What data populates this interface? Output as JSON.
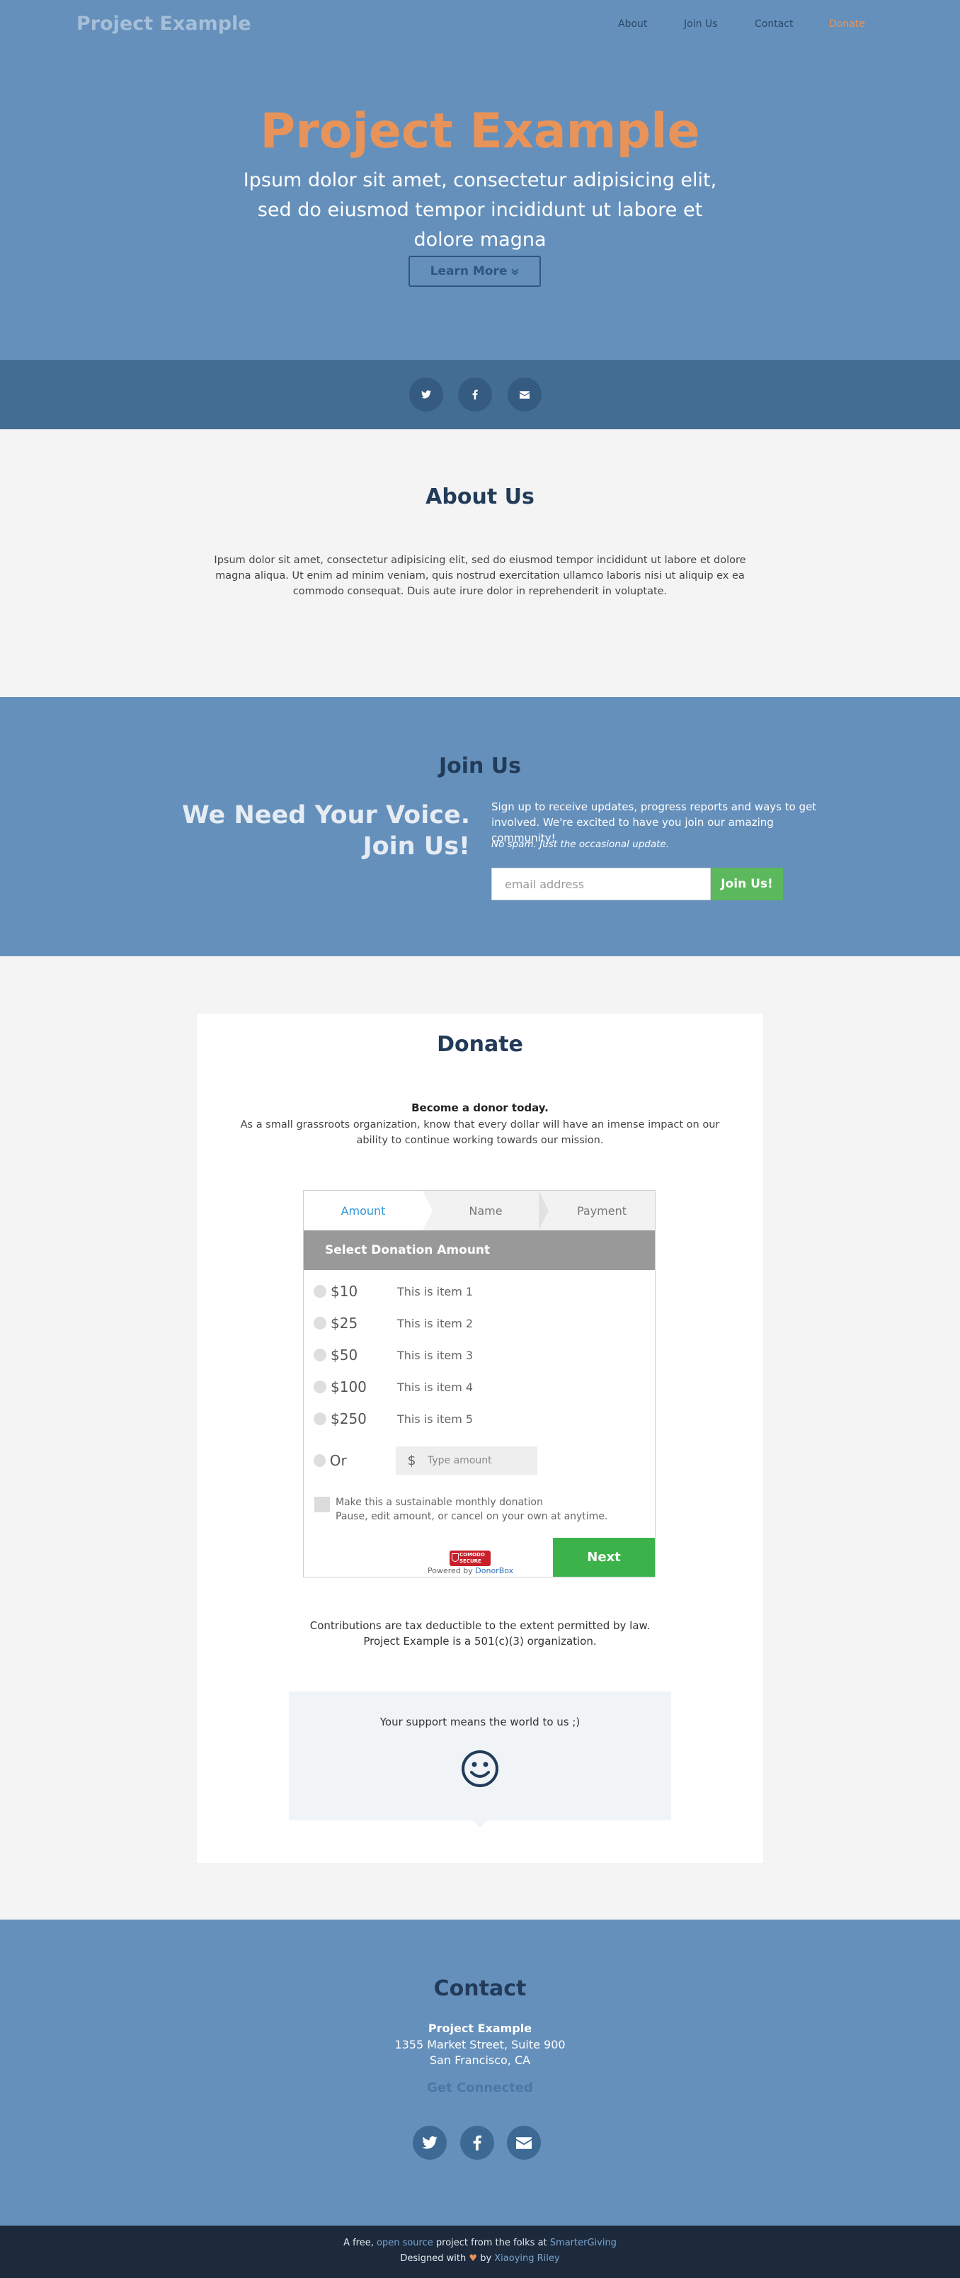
{
  "nav": {
    "brand": "Project Example",
    "links": [
      "About",
      "Join Us",
      "Contact",
      "Donate"
    ]
  },
  "hero": {
    "title": "Project Example",
    "subtitle": "Ipsum dolor sit amet, consectetur adipisicing elit, sed do eiusmod tempor incididunt ut labore et dolore magna",
    "button_label": "Learn More",
    "button_icon": "chevron-down-icon"
  },
  "social_icons": [
    "twitter-icon",
    "facebook-icon",
    "envelope-icon"
  ],
  "about": {
    "title": "About Us",
    "text": "Ipsum dolor sit amet, consectetur adipisicing elit, sed do eiusmod tempor incididunt ut labore et dolore magna aliqua. Ut enim ad minim veniam, quis nostrud exercitation ullamco laboris nisi ut aliquip ex ea commodo consequat. Duis aute irure dolor in reprehenderit in voluptate."
  },
  "join": {
    "title": "Join Us",
    "headline_1": "We Need Your Voice.",
    "headline_2": "Join Us!",
    "description": "Sign up to receive updates, progress reports and ways to get involved. We're excited to have you join our amazing community!",
    "note": "No spam. Just the occasional update.",
    "email_placeholder": "email address",
    "button_label": "Join Us!"
  },
  "donate": {
    "title": "Donate",
    "lead": "Become a donor today.",
    "text": "As a small grassroots organization, know that every dollar will have an imense impact on our ability to continue working towards our mission.",
    "widget": {
      "steps": [
        "Amount",
        "Name",
        "Payment"
      ],
      "active_step": "Amount",
      "header": "Select Donation Amount",
      "amounts": [
        {
          "value": "$10",
          "label": "This is item 1"
        },
        {
          "value": "$25",
          "label": "This is item 2"
        },
        {
          "value": "$50",
          "label": "This is item 3"
        },
        {
          "value": "$100",
          "label": "This is item 4"
        },
        {
          "value": "$250",
          "label": "This is item 5"
        }
      ],
      "other_label": "Or",
      "currency_symbol": "$",
      "custom_placeholder": "Type amount",
      "monthly_label": "Make this a sustainable monthly donation",
      "monthly_sub": "Pause, edit amount, or cancel on your own at anytime.",
      "secure_badge_1": "COMODO",
      "secure_badge_2": "SECURE",
      "powered_prefix": "Powered by",
      "powered_link": "DonorBox",
      "next_label": "Next"
    },
    "tax_line_1": "Contributions are tax deductible to the extent permitted by law.",
    "tax_line_2": "Project Example is a 501(c)(3) organization.",
    "support_text": "Your support means the world to us ;)"
  },
  "contact": {
    "title": "Contact",
    "org": "Project Example",
    "address_1": "1355 Market Street, Suite 900",
    "address_2": "San Francisco, CA",
    "get_connected": "Get Connected"
  },
  "footer": {
    "line1_a": "A free,",
    "line1_link1": "open source",
    "line1_b": "project from the folks at",
    "line1_link2": "SmarterGiving",
    "line2_a": "Designed with",
    "line2_b": "by",
    "line2_link": "Xiaoying Riley"
  }
}
